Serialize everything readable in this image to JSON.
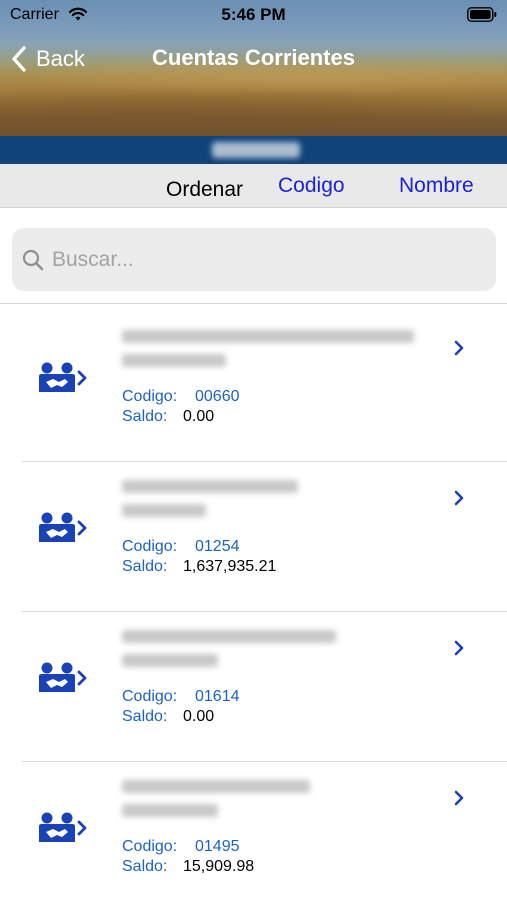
{
  "status_bar": {
    "carrier": "Carrier",
    "time": "5:46 PM"
  },
  "navbar": {
    "back_label": "Back",
    "title": "Cuentas Corrientes"
  },
  "sort": {
    "label": "Ordenar",
    "option_code": "Codigo",
    "option_name": "Nombre"
  },
  "search": {
    "placeholder": "Buscar..."
  },
  "accounts": [
    {
      "code_label": "Codigo:",
      "code": "00660",
      "saldo_label": "Saldo:",
      "saldo": "0.00"
    },
    {
      "code_label": "Codigo:",
      "code": "01254",
      "saldo_label": "Saldo:",
      "saldo": "1,637,935.21"
    },
    {
      "code_label": "Codigo:",
      "code": "01614",
      "saldo_label": "Saldo:",
      "saldo": "0.00"
    },
    {
      "code_label": "Codigo:",
      "code": "01495",
      "saldo_label": "Saldo:",
      "saldo": "15,909.98"
    }
  ],
  "colors": {
    "accent_blue": "#1b63c2",
    "sort_link": "#1a22d6",
    "band_blue": "#11437b",
    "icon_blue": "#1842b5"
  },
  "icons": {
    "wifi": "wifi-icon",
    "battery": "battery-icon",
    "back": "chevron-left-icon",
    "search": "search-icon",
    "account": "handshake-people-icon",
    "disclosure": "chevron-right-icon"
  }
}
